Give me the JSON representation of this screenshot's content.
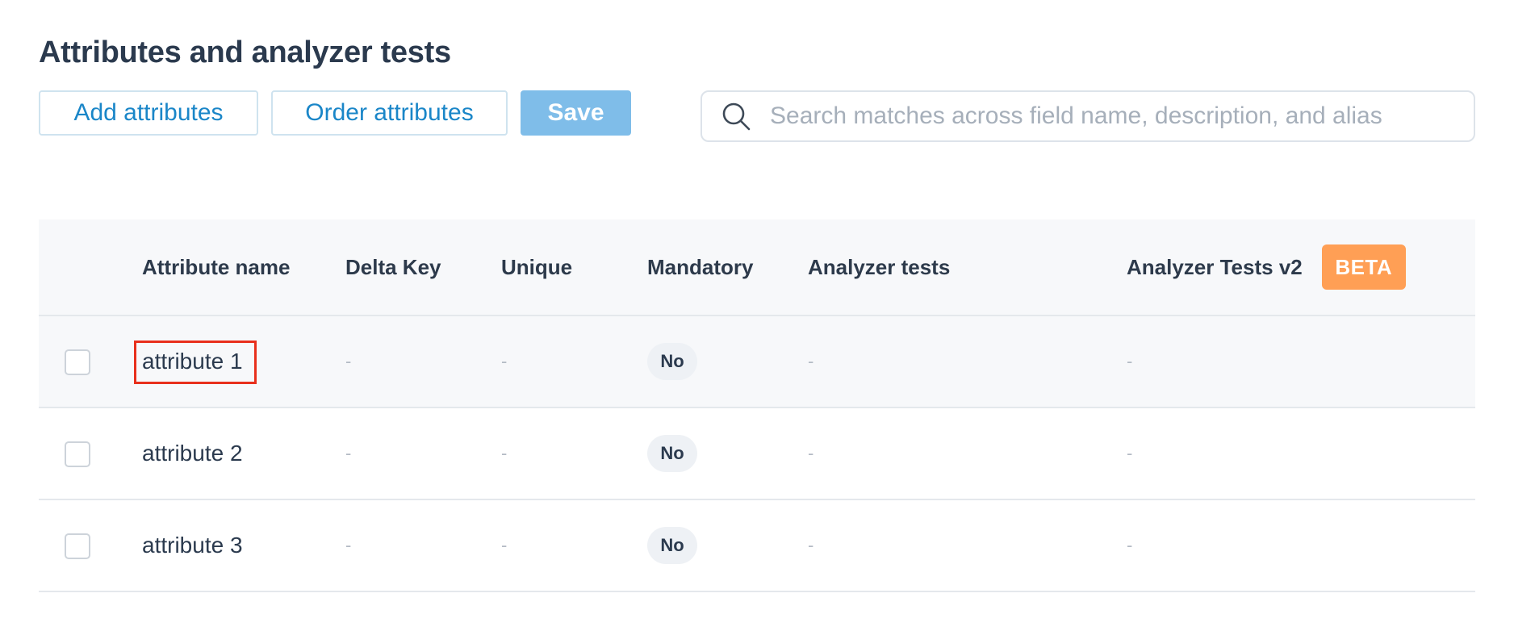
{
  "page": {
    "title": "Attributes and analyzer tests"
  },
  "toolbar": {
    "add_label": "Add attributes",
    "order_label": "Order attributes",
    "save_label": "Save"
  },
  "search": {
    "placeholder": "Search matches across field name, description, and alias",
    "value": "",
    "icon": "search-icon"
  },
  "table": {
    "headers": {
      "name": "Attribute name",
      "delta": "Delta Key",
      "unique": "Unique",
      "mandatory": "Mandatory",
      "analyzer": "Analyzer tests",
      "analyzer_v2": "Analyzer Tests v2",
      "beta_badge": "BETA"
    },
    "rows": [
      {
        "name": "attribute 1",
        "delta": "-",
        "unique": "-",
        "mandatory": "No",
        "analyzer": "-",
        "analyzer_v2": "-"
      },
      {
        "name": "attribute 2",
        "delta": "-",
        "unique": "-",
        "mandatory": "No",
        "analyzer": "-",
        "analyzer_v2": "-"
      },
      {
        "name": "attribute 3",
        "delta": "-",
        "unique": "-",
        "mandatory": "No",
        "analyzer": "-",
        "analyzer_v2": "-"
      }
    ]
  },
  "colors": {
    "accent": "#1a86c8",
    "save_button": "#7fbde9",
    "beta_badge": "#ff9f55",
    "highlight_box": "#e8301c"
  }
}
